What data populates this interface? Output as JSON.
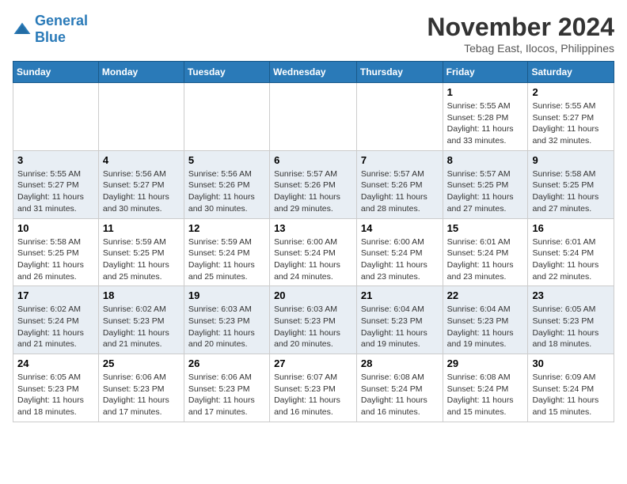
{
  "header": {
    "logo_general": "General",
    "logo_blue": "Blue",
    "month_year": "November 2024",
    "location": "Tebag East, Ilocos, Philippines"
  },
  "days_of_week": [
    "Sunday",
    "Monday",
    "Tuesday",
    "Wednesday",
    "Thursday",
    "Friday",
    "Saturday"
  ],
  "weeks": [
    [
      {
        "day": "",
        "content": ""
      },
      {
        "day": "",
        "content": ""
      },
      {
        "day": "",
        "content": ""
      },
      {
        "day": "",
        "content": ""
      },
      {
        "day": "",
        "content": ""
      },
      {
        "day": "1",
        "content": "Sunrise: 5:55 AM\nSunset: 5:28 PM\nDaylight: 11 hours\nand 33 minutes."
      },
      {
        "day": "2",
        "content": "Sunrise: 5:55 AM\nSunset: 5:27 PM\nDaylight: 11 hours\nand 32 minutes."
      }
    ],
    [
      {
        "day": "3",
        "content": "Sunrise: 5:55 AM\nSunset: 5:27 PM\nDaylight: 11 hours\nand 31 minutes."
      },
      {
        "day": "4",
        "content": "Sunrise: 5:56 AM\nSunset: 5:27 PM\nDaylight: 11 hours\nand 30 minutes."
      },
      {
        "day": "5",
        "content": "Sunrise: 5:56 AM\nSunset: 5:26 PM\nDaylight: 11 hours\nand 30 minutes."
      },
      {
        "day": "6",
        "content": "Sunrise: 5:57 AM\nSunset: 5:26 PM\nDaylight: 11 hours\nand 29 minutes."
      },
      {
        "day": "7",
        "content": "Sunrise: 5:57 AM\nSunset: 5:26 PM\nDaylight: 11 hours\nand 28 minutes."
      },
      {
        "day": "8",
        "content": "Sunrise: 5:57 AM\nSunset: 5:25 PM\nDaylight: 11 hours\nand 27 minutes."
      },
      {
        "day": "9",
        "content": "Sunrise: 5:58 AM\nSunset: 5:25 PM\nDaylight: 11 hours\nand 27 minutes."
      }
    ],
    [
      {
        "day": "10",
        "content": "Sunrise: 5:58 AM\nSunset: 5:25 PM\nDaylight: 11 hours\nand 26 minutes."
      },
      {
        "day": "11",
        "content": "Sunrise: 5:59 AM\nSunset: 5:25 PM\nDaylight: 11 hours\nand 25 minutes."
      },
      {
        "day": "12",
        "content": "Sunrise: 5:59 AM\nSunset: 5:24 PM\nDaylight: 11 hours\nand 25 minutes."
      },
      {
        "day": "13",
        "content": "Sunrise: 6:00 AM\nSunset: 5:24 PM\nDaylight: 11 hours\nand 24 minutes."
      },
      {
        "day": "14",
        "content": "Sunrise: 6:00 AM\nSunset: 5:24 PM\nDaylight: 11 hours\nand 23 minutes."
      },
      {
        "day": "15",
        "content": "Sunrise: 6:01 AM\nSunset: 5:24 PM\nDaylight: 11 hours\nand 23 minutes."
      },
      {
        "day": "16",
        "content": "Sunrise: 6:01 AM\nSunset: 5:24 PM\nDaylight: 11 hours\nand 22 minutes."
      }
    ],
    [
      {
        "day": "17",
        "content": "Sunrise: 6:02 AM\nSunset: 5:24 PM\nDaylight: 11 hours\nand 21 minutes."
      },
      {
        "day": "18",
        "content": "Sunrise: 6:02 AM\nSunset: 5:23 PM\nDaylight: 11 hours\nand 21 minutes."
      },
      {
        "day": "19",
        "content": "Sunrise: 6:03 AM\nSunset: 5:23 PM\nDaylight: 11 hours\nand 20 minutes."
      },
      {
        "day": "20",
        "content": "Sunrise: 6:03 AM\nSunset: 5:23 PM\nDaylight: 11 hours\nand 20 minutes."
      },
      {
        "day": "21",
        "content": "Sunrise: 6:04 AM\nSunset: 5:23 PM\nDaylight: 11 hours\nand 19 minutes."
      },
      {
        "day": "22",
        "content": "Sunrise: 6:04 AM\nSunset: 5:23 PM\nDaylight: 11 hours\nand 19 minutes."
      },
      {
        "day": "23",
        "content": "Sunrise: 6:05 AM\nSunset: 5:23 PM\nDaylight: 11 hours\nand 18 minutes."
      }
    ],
    [
      {
        "day": "24",
        "content": "Sunrise: 6:05 AM\nSunset: 5:23 PM\nDaylight: 11 hours\nand 18 minutes."
      },
      {
        "day": "25",
        "content": "Sunrise: 6:06 AM\nSunset: 5:23 PM\nDaylight: 11 hours\nand 17 minutes."
      },
      {
        "day": "26",
        "content": "Sunrise: 6:06 AM\nSunset: 5:23 PM\nDaylight: 11 hours\nand 17 minutes."
      },
      {
        "day": "27",
        "content": "Sunrise: 6:07 AM\nSunset: 5:23 PM\nDaylight: 11 hours\nand 16 minutes."
      },
      {
        "day": "28",
        "content": "Sunrise: 6:08 AM\nSunset: 5:24 PM\nDaylight: 11 hours\nand 16 minutes."
      },
      {
        "day": "29",
        "content": "Sunrise: 6:08 AM\nSunset: 5:24 PM\nDaylight: 11 hours\nand 15 minutes."
      },
      {
        "day": "30",
        "content": "Sunrise: 6:09 AM\nSunset: 5:24 PM\nDaylight: 11 hours\nand 15 minutes."
      }
    ]
  ]
}
